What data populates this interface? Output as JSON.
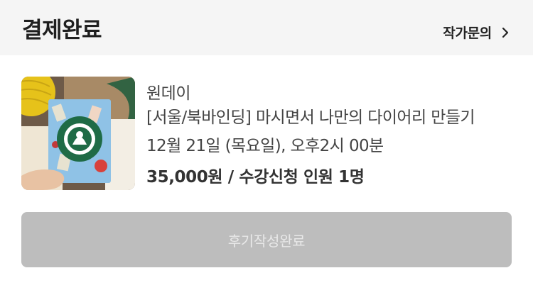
{
  "header": {
    "title": "결제완료",
    "contact_label": "작가문의"
  },
  "order": {
    "maker": "원데이",
    "product_name": "[서울/북바인딩] 마시면서 나만의 다이어리 만들기",
    "schedule": "12월 21일 (목요일), 오후2시 00분",
    "price_summary": "35,000원 / 수강신청 인원 1명"
  },
  "review_button": {
    "label": "후기작성완료",
    "state": "disabled"
  },
  "colors": {
    "header_bg": "#f5f5f5",
    "button_bg": "#bdbdbd",
    "button_text": "#e8e8e8"
  }
}
